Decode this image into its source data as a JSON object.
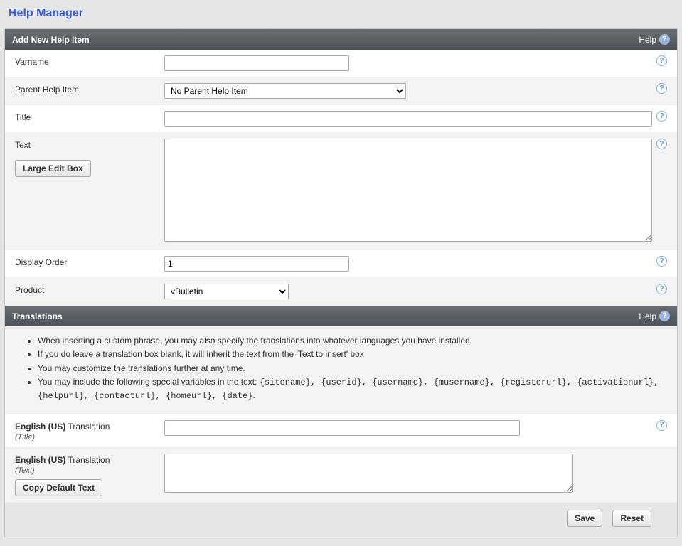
{
  "page": {
    "title": "Help Manager"
  },
  "panel1": {
    "title": "Add New Help Item",
    "helpLabel": "Help",
    "fields": {
      "varname": {
        "label": "Varname",
        "value": ""
      },
      "parent": {
        "label": "Parent Help Item",
        "selected": "No Parent Help Item"
      },
      "title": {
        "label": "Title",
        "value": ""
      },
      "text": {
        "label": "Text",
        "button": "Large Edit Box",
        "value": ""
      },
      "displayOrder": {
        "label": "Display Order",
        "value": "1"
      },
      "product": {
        "label": "Product",
        "selected": "vBulletin"
      }
    }
  },
  "panel2": {
    "title": "Translations",
    "helpLabel": "Help",
    "bullets": [
      "When inserting a custom phrase, you may also specify the translations into whatever languages you have installed.",
      "If you do leave a translation box blank, it will inherit the text from the 'Text to insert' box",
      "You may customize the translations further at any time."
    ],
    "bullet4_prefix": "You may include the following special variables in the text: ",
    "bullet4_vars": "{sitename}, {userid}, {username}, {musername}, {registerurl}, {activationurl}, {helpurl}, {contacturl}, {homeurl}, {date}",
    "bullet4_suffix": ".",
    "translation": {
      "langBold": "English (US)",
      "word": "Translation",
      "titleSub": "(Title)",
      "textSub": "(Text)",
      "copyButton": "Copy Default Text",
      "titleValue": "",
      "textValue": ""
    }
  },
  "actions": {
    "save": "Save",
    "reset": "Reset"
  }
}
